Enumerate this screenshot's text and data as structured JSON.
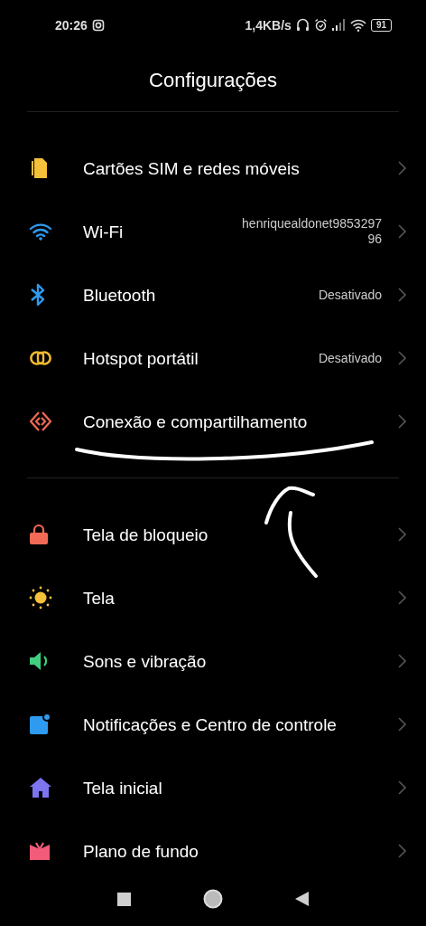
{
  "status_bar": {
    "time": "20:26",
    "speed": "1,4KB/s",
    "battery": "91"
  },
  "title": "Configurações",
  "sections": [
    {
      "items": [
        {
          "label": "Cartões SIM e redes móveis"
        },
        {
          "label": "Wi-Fi",
          "value": "henriquealdonet985329796"
        },
        {
          "label": "Bluetooth",
          "value": "Desativado"
        },
        {
          "label": "Hotspot portátil",
          "value": "Desativado"
        },
        {
          "label": "Conexão e compartilhamento"
        }
      ]
    },
    {
      "items": [
        {
          "label": "Tela de bloqueio"
        },
        {
          "label": "Tela"
        },
        {
          "label": "Sons e vibração"
        },
        {
          "label": "Notificações e Centro de controle"
        },
        {
          "label": "Tela inicial"
        },
        {
          "label": "Plano de fundo"
        }
      ]
    }
  ]
}
